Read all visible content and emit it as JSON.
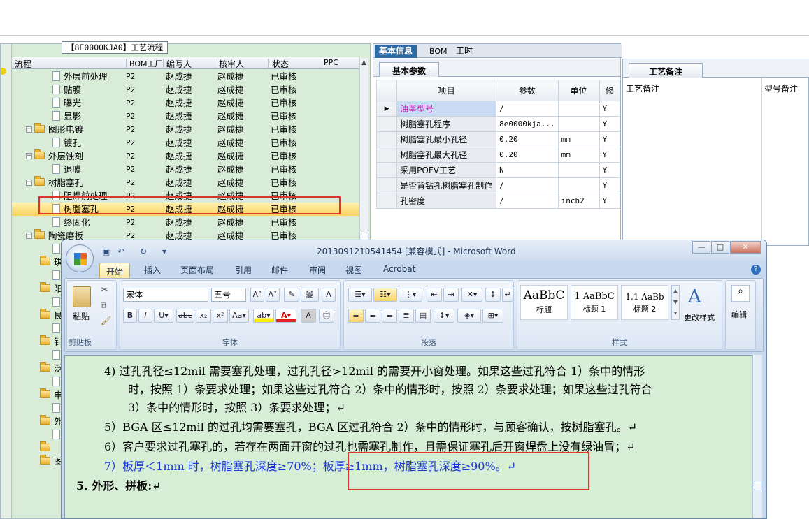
{
  "tree_panel": {
    "title": "【8E0000KJA0】工艺流程",
    "headers": [
      "流程",
      "BOM工厂",
      "编写人",
      "核审人",
      "状态",
      "PPC"
    ],
    "rows": [
      {
        "name": "外层前处理",
        "bom": "P2",
        "writer": "赵成捷",
        "reviewer": "赵成捷",
        "status": "已审核",
        "type": "doc",
        "indent": 2
      },
      {
        "name": "贴膜",
        "bom": "P2",
        "writer": "赵成捷",
        "reviewer": "赵成捷",
        "status": "已审核",
        "type": "doc",
        "indent": 2
      },
      {
        "name": "曝光",
        "bom": "P2",
        "writer": "赵成捷",
        "reviewer": "赵成捷",
        "status": "已审核",
        "type": "doc",
        "indent": 2
      },
      {
        "name": "显影",
        "bom": "P2",
        "writer": "赵成捷",
        "reviewer": "赵成捷",
        "status": "已审核",
        "type": "doc",
        "indent": 2
      },
      {
        "name": "图形电镀",
        "bom": "P2",
        "writer": "赵成捷",
        "reviewer": "赵成捷",
        "status": "已审核",
        "type": "folder",
        "indent": 1
      },
      {
        "name": "镀孔",
        "bom": "P2",
        "writer": "赵成捷",
        "reviewer": "赵成捷",
        "status": "已审核",
        "type": "doc",
        "indent": 2
      },
      {
        "name": "外层蚀刻",
        "bom": "P2",
        "writer": "赵成捷",
        "reviewer": "赵成捷",
        "status": "已审核",
        "type": "folder",
        "indent": 1
      },
      {
        "name": "退膜",
        "bom": "P2",
        "writer": "赵成捷",
        "reviewer": "赵成捷",
        "status": "已审核",
        "type": "doc",
        "indent": 2
      },
      {
        "name": "树脂塞孔",
        "bom": "P2",
        "writer": "赵成捷",
        "reviewer": "赵成捷",
        "status": "已审核",
        "type": "folder",
        "indent": 1
      },
      {
        "name": "阻焊前处理",
        "bom": "P2",
        "writer": "赵成捷",
        "reviewer": "赵成捷",
        "status": "已审核",
        "type": "doc",
        "indent": 2
      },
      {
        "name": "树脂塞孔",
        "bom": "P2",
        "writer": "赵成捷",
        "reviewer": "赵成捷",
        "status": "已审核",
        "type": "doc",
        "indent": 2,
        "selected": true
      },
      {
        "name": "终固化",
        "bom": "P2",
        "writer": "赵成捷",
        "reviewer": "赵成捷",
        "status": "已审核",
        "type": "doc",
        "indent": 2
      },
      {
        "name": "陶瓷磨板",
        "bom": "P2",
        "writer": "赵成捷",
        "reviewer": "赵成捷",
        "status": "已审核",
        "type": "folder",
        "indent": 1
      }
    ],
    "partial_rows": [
      "",
      "琪",
      "",
      "阳",
      "",
      "艮",
      "",
      "钅",
      "",
      "泛",
      "",
      "申",
      "",
      "外",
      "",
      "",
      "图"
    ]
  },
  "info_panel": {
    "tabs": [
      "基本信息",
      "BOM",
      "工时"
    ],
    "subtab": "基本参数",
    "columns": [
      "项目",
      "参数",
      "单位",
      "修"
    ],
    "rows": [
      {
        "marker": "▶",
        "item": "油墨型号",
        "value": "/",
        "unit": "",
        "flag": "Y",
        "highlight": true
      },
      {
        "marker": "",
        "item": "树脂塞孔程序",
        "value": "8e0000kja...",
        "unit": "",
        "flag": "Y"
      },
      {
        "marker": "",
        "item": "树脂塞孔最小孔径",
        "value": "0.20",
        "unit": "mm",
        "flag": "Y"
      },
      {
        "marker": "",
        "item": "树脂塞孔最大孔径",
        "value": "0.20",
        "unit": "mm",
        "flag": "Y"
      },
      {
        "marker": "",
        "item": "采用POFV工艺",
        "value": "N",
        "unit": "",
        "flag": "Y"
      },
      {
        "marker": "",
        "item": "是否背钻孔树脂塞孔制作",
        "value": "/",
        "unit": "",
        "flag": "Y"
      },
      {
        "marker": "",
        "item": "孔密度",
        "value": "/",
        "unit": "inch2",
        "flag": "Y"
      }
    ]
  },
  "notes_panel": {
    "subtab": "工艺备注",
    "columns": [
      "工艺备注",
      "型号备注"
    ]
  },
  "word": {
    "title": "2013091210541454 [兼容模式] - Microsoft Word",
    "tabs": [
      "开始",
      "插入",
      "页面布局",
      "引用",
      "邮件",
      "审阅",
      "视图",
      "Acrobat"
    ],
    "clipboard": {
      "paste": "粘贴",
      "label": "剪贴板"
    },
    "font": {
      "name": "宋体",
      "size": "五号",
      "label": "字体"
    },
    "paragraph_label": "段落",
    "styles": {
      "label": "样式",
      "items": [
        {
          "preview": "AaBbC",
          "name": "标题"
        },
        {
          "preview": "1 AaBbC",
          "name": "标题 1"
        },
        {
          "preview": "1.1 AaBb",
          "name": "标题 2"
        }
      ],
      "change": "更改样式"
    },
    "editing": "编辑",
    "lines": [
      {
        "text": "4)  过孔孔径≤12mil 需要塞孔处理，过孔孔径>12mil 的需要开小窗处理。如果这些过孔符合 1）条中的情形",
        "color": "#000"
      },
      {
        "text": "时，按照 1）条要求处理；如果这些过孔符合 2）条中的情形时，按照 2）条要求处理；如果这些过孔符合",
        "color": "#000"
      },
      {
        "text": "3）条中的情形时，按照 3）条要求处理；↵",
        "color": "#000"
      },
      {
        "text": "5）BGA 区≤12mil 的过孔均需要塞孔，BGA 区过孔符合 2）条中的情形时，与顾客确认，按树脂塞孔。↵",
        "color": "#000"
      },
      {
        "text": "6）客户要求过孔塞孔的，若存在两面开窗的过孔也需塞孔制作，且需保证塞孔后开窗焊盘上没有绿油冒；↵",
        "color": "#000"
      },
      {
        "text": "7）板厚＜1mm 时，树脂塞孔深度≥70%；板厚≥1mm，树脂塞孔深度≥90%。↵",
        "color": "#1a35d6"
      },
      {
        "text": "5.   外形、拼板:↵",
        "color": "#000",
        "bold": true
      }
    ]
  }
}
